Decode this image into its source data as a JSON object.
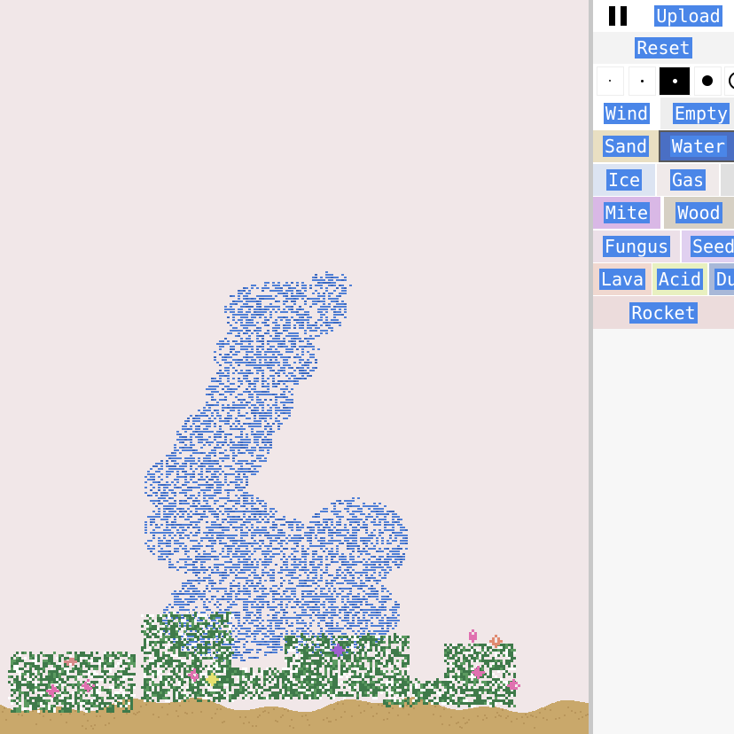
{
  "toolbar": {
    "pause_icon": "pause-icon",
    "upload_label": "Upload",
    "reset_label": "Reset"
  },
  "brush_sizes": {
    "options": [
      "tiny",
      "small",
      "medium",
      "large",
      "xlarge"
    ],
    "selected": "medium"
  },
  "elements": [
    {
      "label": "Wind",
      "color": "#e6e6e6"
    },
    {
      "label": "Empty",
      "color": "#eeeeee"
    },
    {
      "label": "Sand",
      "color": "#dcc68c"
    },
    {
      "label": "Water",
      "color": "#4a6fc4",
      "selected": true
    },
    {
      "label": "Ice",
      "color": "#dce4f2"
    },
    {
      "label": "Gas",
      "color": "#f0eaea"
    },
    {
      "label": "Mite",
      "color": "#d9b8e6"
    },
    {
      "label": "Wood",
      "color": "#d6d0c4"
    },
    {
      "label": "Fungus",
      "color": "#ece0e8"
    },
    {
      "label": "Seed",
      "color": "#e0d0f0"
    },
    {
      "label": "Lava",
      "color": "#f0d8d0"
    },
    {
      "label": "Acid",
      "color": "#e8f0c0"
    },
    {
      "label": "Du",
      "color": "#a8b8d8"
    },
    {
      "label": "Rocket",
      "color": "#ecdcdc"
    }
  ],
  "colors": {
    "background": "#f1e7e8",
    "sand": "#c9a86b",
    "water": "#4f7fd6",
    "plant": "#3f7a4a",
    "flower_pink": "#e070b0",
    "flower_purple": "#a060d0"
  }
}
